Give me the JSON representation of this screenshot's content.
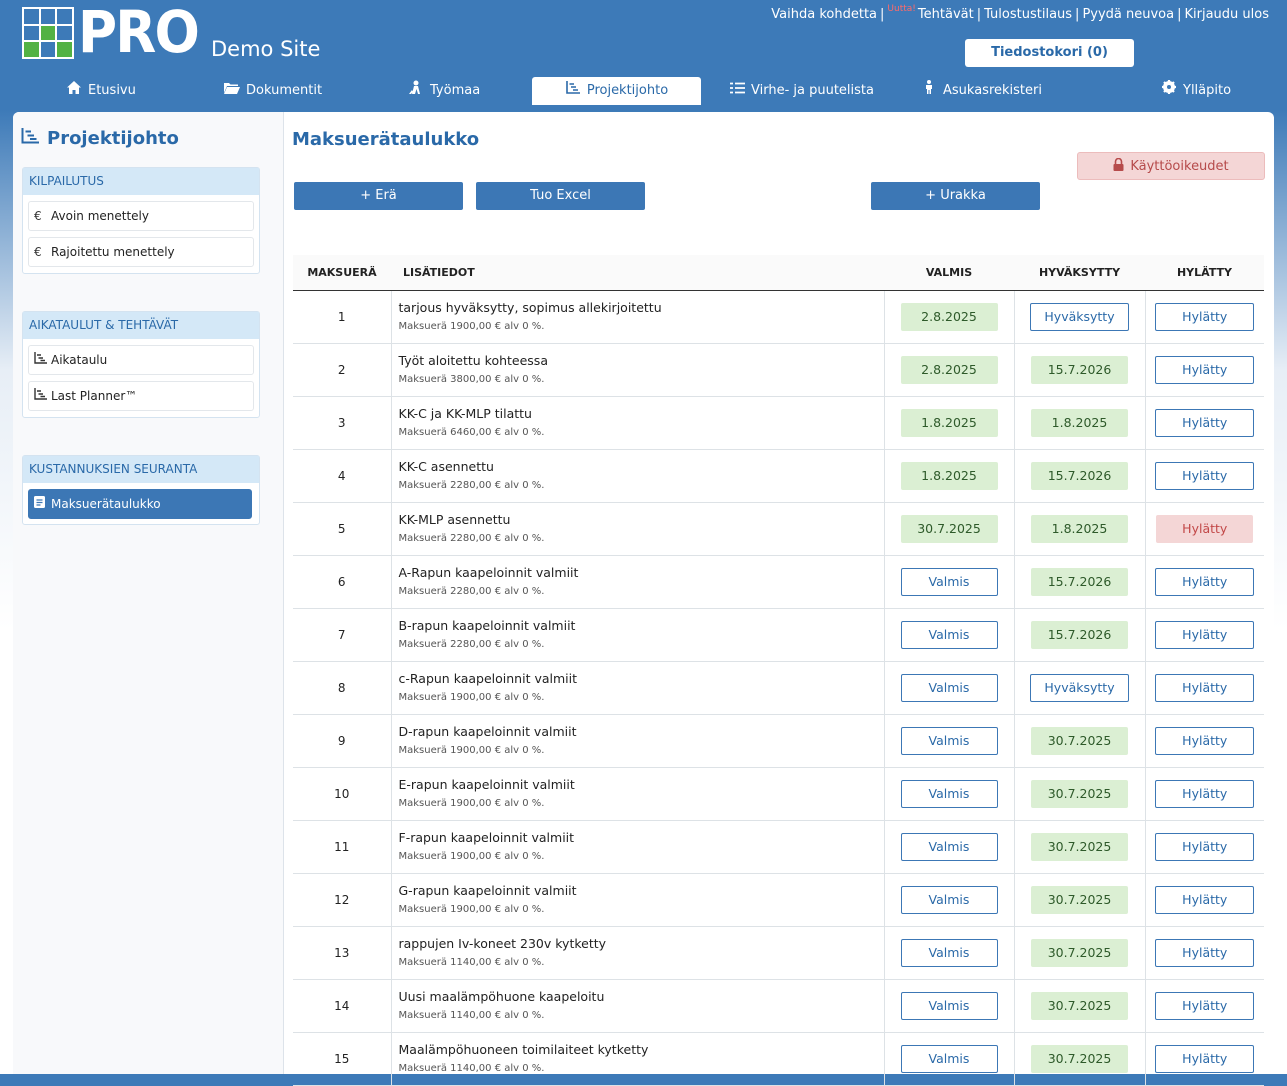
{
  "brand": {
    "logo_text": "PRO",
    "site_name": "Demo Site"
  },
  "toplinks": {
    "change_target": "Vaihda kohdetta",
    "new_badge": "Uutta!",
    "tasks": "Tehtävät",
    "print_order": "Tulostustilaus",
    "ask_advice": "Pyydä neuvoa",
    "logout": "Kirjaudu ulos"
  },
  "cart": {
    "label": "Tiedostokori (0)"
  },
  "nav": [
    {
      "label": "Etusivu",
      "icon": "home-icon"
    },
    {
      "label": "Dokumentit",
      "icon": "folder-icon"
    },
    {
      "label": "Työmaa",
      "icon": "worker-icon"
    },
    {
      "label": "Projektijohto",
      "icon": "chart-icon"
    },
    {
      "label": "Virhe- ja puutelista",
      "icon": "list-icon"
    },
    {
      "label": "Asukasrekisteri",
      "icon": "person-icon"
    },
    {
      "label": "Ylläpito",
      "icon": "gear-icon"
    }
  ],
  "sidebar": {
    "title": "Projektijohto",
    "sections": [
      {
        "header": "KILPAILUTUS",
        "items": [
          {
            "label": "Avoin menettely",
            "icon": "euro-icon"
          },
          {
            "label": "Rajoitettu menettely",
            "icon": "euro-icon"
          }
        ]
      },
      {
        "header": "AIKATAULUT & TEHTÄVÄT",
        "items": [
          {
            "label": "Aikataulu",
            "icon": "chart-icon"
          },
          {
            "label": "Last Planner™",
            "icon": "chart-icon"
          }
        ]
      },
      {
        "header": "KUSTANNUKSIEN SEURANTA",
        "items": [
          {
            "label": "Maksuerätaulukko",
            "icon": "document-icon"
          }
        ]
      }
    ]
  },
  "main": {
    "title": "Maksuerätaulukko",
    "buttons": {
      "add_batch": "+ Erä",
      "import_excel": "Tuo Excel",
      "add_contract": "+ Urakka",
      "rights": "Käyttöoikeudet"
    },
    "columns": {
      "batch": "MAKSUERÄ",
      "info": "LISÄTIEDOT",
      "done": "VALMIS",
      "approved": "HYVÄKSYTTY",
      "rejected": "HYLÄTTY"
    },
    "rows": [
      {
        "num": "1",
        "title": "tarjous hyväksytty, sopimus allekirjoitettu",
        "sub": "Maksuerä 1900,00 € alv 0 %.",
        "done": "2.8.2025",
        "done_state": "date",
        "approved": "Hyväksytty",
        "approved_state": "button",
        "rejected": "Hylätty",
        "rejected_state": "button"
      },
      {
        "num": "2",
        "title": "Työt aloitettu kohteessa",
        "sub": "Maksuerä 3800,00 € alv 0 %.",
        "done": "2.8.2025",
        "done_state": "date",
        "approved": "15.7.2026",
        "approved_state": "date",
        "rejected": "Hylätty",
        "rejected_state": "button"
      },
      {
        "num": "3",
        "title": "KK-C ja KK-MLP tilattu",
        "sub": "Maksuerä 6460,00 € alv 0 %.",
        "done": "1.8.2025",
        "done_state": "date",
        "approved": "1.8.2025",
        "approved_state": "date",
        "rejected": "Hylätty",
        "rejected_state": "button"
      },
      {
        "num": "4",
        "title": "KK-C asennettu",
        "sub": "Maksuerä 2280,00 € alv 0 %.",
        "done": "1.8.2025",
        "done_state": "date",
        "approved": "15.7.2026",
        "approved_state": "date",
        "rejected": "Hylätty",
        "rejected_state": "button"
      },
      {
        "num": "5",
        "title": "KK-MLP asennettu",
        "sub": "Maksuerä 2280,00 € alv 0 %.",
        "done": "30.7.2025",
        "done_state": "date",
        "approved": "1.8.2025",
        "approved_state": "date",
        "rejected": "Hylätty",
        "rejected_state": "rejected"
      },
      {
        "num": "6",
        "title": "A-Rapun kaapeloinnit valmiit",
        "sub": "Maksuerä 2280,00 € alv 0 %.",
        "done": "Valmis",
        "done_state": "button",
        "approved": "15.7.2026",
        "approved_state": "date",
        "rejected": "Hylätty",
        "rejected_state": "button"
      },
      {
        "num": "7",
        "title": "B-rapun kaapeloinnit valmiit",
        "sub": "Maksuerä 2280,00 € alv 0 %.",
        "done": "Valmis",
        "done_state": "button",
        "approved": "15.7.2026",
        "approved_state": "date",
        "rejected": "Hylätty",
        "rejected_state": "button"
      },
      {
        "num": "8",
        "title": "c-Rapun kaapeloinnit valmiit",
        "sub": "Maksuerä 1900,00 € alv 0 %.",
        "done": "Valmis",
        "done_state": "button",
        "approved": "Hyväksytty",
        "approved_state": "button",
        "rejected": "Hylätty",
        "rejected_state": "button"
      },
      {
        "num": "9",
        "title": "D-rapun kaapeloinnit valmiit",
        "sub": "Maksuerä 1900,00 € alv 0 %.",
        "done": "Valmis",
        "done_state": "button",
        "approved": "30.7.2025",
        "approved_state": "date",
        "rejected": "Hylätty",
        "rejected_state": "button"
      },
      {
        "num": "10",
        "title": "E-rapun kaapeloinnit valmiit",
        "sub": "Maksuerä 1900,00 € alv 0 %.",
        "done": "Valmis",
        "done_state": "button",
        "approved": "30.7.2025",
        "approved_state": "date",
        "rejected": "Hylätty",
        "rejected_state": "button"
      },
      {
        "num": "11",
        "title": "F-rapun kaapeloinnit valmiit",
        "sub": "Maksuerä 1900,00 € alv 0 %.",
        "done": "Valmis",
        "done_state": "button",
        "approved": "30.7.2025",
        "approved_state": "date",
        "rejected": "Hylätty",
        "rejected_state": "button"
      },
      {
        "num": "12",
        "title": "G-rapun kaapeloinnit valmiit",
        "sub": "Maksuerä 1900,00 € alv 0 %.",
        "done": "Valmis",
        "done_state": "button",
        "approved": "30.7.2025",
        "approved_state": "date",
        "rejected": "Hylätty",
        "rejected_state": "button"
      },
      {
        "num": "13",
        "title": "rappujen Iv-koneet 230v kytketty",
        "sub": "Maksuerä 1140,00 € alv 0 %.",
        "done": "Valmis",
        "done_state": "button",
        "approved": "30.7.2025",
        "approved_state": "date",
        "rejected": "Hylätty",
        "rejected_state": "button"
      },
      {
        "num": "14",
        "title": "Uusi maalämpöhuone kaapeloitu",
        "sub": "Maksuerä 1140,00 € alv 0 %.",
        "done": "Valmis",
        "done_state": "button",
        "approved": "30.7.2025",
        "approved_state": "date",
        "rejected": "Hylätty",
        "rejected_state": "button"
      },
      {
        "num": "15",
        "title": "Maalämpöhuoneen toimilaiteet kytketty",
        "sub": "Maksuerä 1140,00 € alv 0 %.",
        "done": "Valmis",
        "done_state": "button",
        "approved": "30.7.2025",
        "approved_state": "date",
        "rejected": "Hylätty",
        "rejected_state": "button"
      }
    ]
  },
  "colors": {
    "brand_blue": "#3d7ab8",
    "logo_green": "#53b244",
    "done_green": "#dbefd3",
    "rejected_red": "#f4d6d6"
  }
}
